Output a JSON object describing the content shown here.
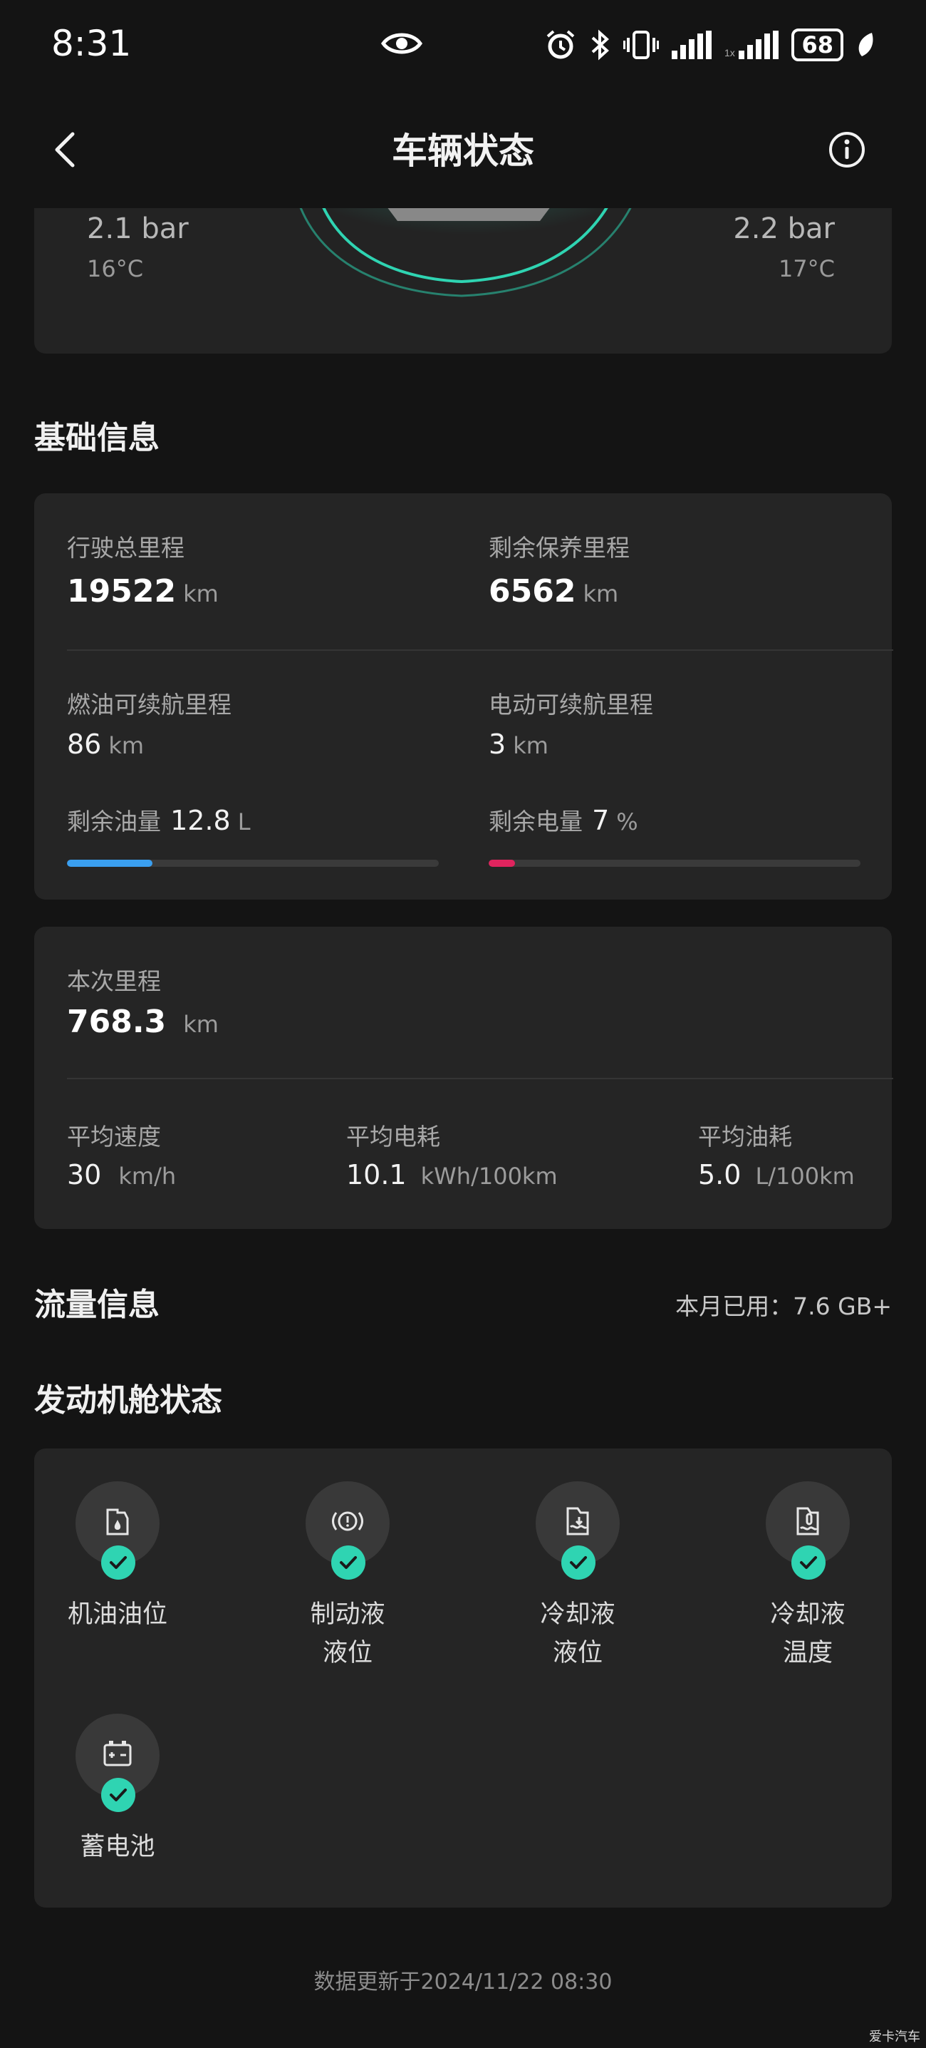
{
  "status_bar": {
    "time": "8:31",
    "battery": "68"
  },
  "header": {
    "title": "车辆状态"
  },
  "tires": {
    "left": {
      "pressure": "2.1 bar",
      "temp": "16°C"
    },
    "right": {
      "pressure": "2.2 bar",
      "temp": "17°C"
    }
  },
  "basic": {
    "title": "基础信息",
    "total_mileage": {
      "label": "行驶总里程",
      "value": "19522",
      "unit": "km"
    },
    "maintenance": {
      "label": "剩余保养里程",
      "value": "6562",
      "unit": "km"
    },
    "fuel_range": {
      "label": "燃油可续航里程",
      "value": "86",
      "unit": "km"
    },
    "ev_range": {
      "label": "电动可续航里程",
      "value": "3",
      "unit": "km"
    },
    "fuel_left": {
      "label": "剩余油量",
      "value": "12.8",
      "unit": "L",
      "level_percent": 23,
      "color": "#3a9ff0"
    },
    "battery_left": {
      "label": "剩余电量",
      "value": "7",
      "unit": "%",
      "level_percent": 7,
      "color": "#e0245e"
    }
  },
  "trip": {
    "label": "本次里程",
    "value": "768.3",
    "unit": "km",
    "avg_speed": {
      "label": "平均速度",
      "value": "30",
      "unit": "km/h"
    },
    "avg_power": {
      "label": "平均电耗",
      "value": "10.1",
      "unit": "kWh/100km"
    },
    "avg_fuel": {
      "label": "平均油耗",
      "value": "5.0",
      "unit": "L/100km"
    }
  },
  "traffic": {
    "title": "流量信息",
    "usage": "本月已用：7.6 GB+"
  },
  "engine": {
    "title": "发动机舱状态",
    "accent": "#2fd4b2",
    "items": [
      {
        "label": "机油油位",
        "icon": "oil-can-icon"
      },
      {
        "label": "制动液\n液位",
        "icon": "brake-icon"
      },
      {
        "label": "冷却液\n液位",
        "icon": "coolant-level-icon"
      },
      {
        "label": "冷却液\n温度",
        "icon": "coolant-temp-icon"
      },
      {
        "label": "蓄电池",
        "icon": "battery-icon"
      }
    ]
  },
  "footer": {
    "updated": "数据更新于2024/11/22 08:30"
  },
  "watermark": "爱卡汽车"
}
